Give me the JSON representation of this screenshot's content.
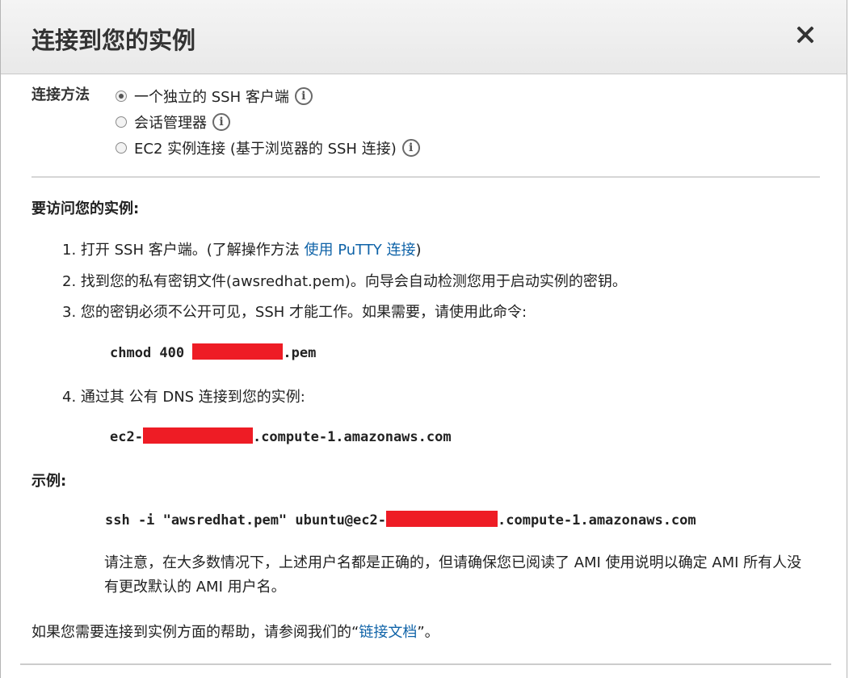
{
  "dialog": {
    "title": "连接到您的实例",
    "close_label": "close"
  },
  "connection": {
    "label": "连接方法",
    "options": [
      {
        "label": "一个独立的 SSH 客户端",
        "selected": true
      },
      {
        "label": "会话管理器",
        "selected": false
      },
      {
        "label": "EC2 实例连接 (基于浏览器的 SSH 连接)",
        "selected": false
      }
    ],
    "info_glyph": "i"
  },
  "access": {
    "heading": "要访问您的实例:",
    "step1_prefix": "1. 打开 SSH 客户端。(了解操作方法 ",
    "step1_link": "使用 PuTTY 连接",
    "step1_suffix": ")",
    "step2": "2. 找到您的私有密钥文件(awsredhat.pem)。向导会自动检测您用于启动实例的密钥。",
    "step3": "3. 您的密钥必须不公开可见，SSH 才能工作。如果需要，请使用此命令:",
    "chmod_prefix": "chmod 400 ",
    "chmod_suffix": ".pem",
    "step4": "4. 通过其 公有 DNS 连接到您的实例:",
    "dns_prefix": "ec2-",
    "dns_suffix": ".compute-1.amazonaws.com"
  },
  "example": {
    "heading": "示例:",
    "ssh_prefix": "ssh -i \"awsredhat.pem\" ubuntu@ec2-",
    "ssh_suffix": ".compute-1.amazonaws.com",
    "note": "请注意，在大多数情况下，上述用户名都是正确的，但请确保您已阅读了 AMI 使用说明以确定 AMI 所有人没有更改默认的 AMI 用户名。"
  },
  "help": {
    "prefix": "如果您需要连接到实例方面的帮助，请参阅我们的“",
    "link": "链接文档",
    "suffix": "”。"
  },
  "colors": {
    "redaction": "#ee1c25",
    "link": "#0f63a8"
  }
}
